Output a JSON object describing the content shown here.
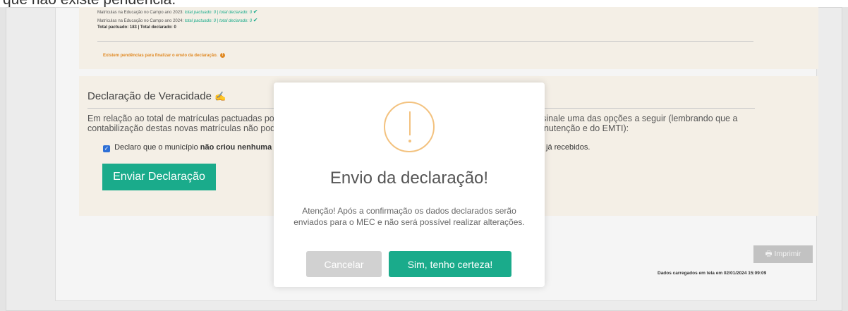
{
  "top_cut_text": "que não existe pendência.",
  "summary": {
    "line1_prefix": "Matrículas na Educação no Campo ano 2023:",
    "line1_values": "total pactuado: 0 | total declarado: 0",
    "line2_prefix": "Matrículas na Educação no Campo ano 2024:",
    "line2_values": "total pactuado: 0 | total declarado: 0",
    "total": "Total pactuado: 183 | Total declarado: 0",
    "pendencia": "Existem pendências para finalizar o envio da declaração.",
    "check_icon": "check-icon",
    "status_color": "#1aab8b",
    "warning_color": "#e08a25"
  },
  "declaracao": {
    "title": "Declaração de Veracidade",
    "title_icon": "signature-icon",
    "text_line1_left": "Em relação ao total de matrículas pactuadas por",
    "text_line1_right": ", assinale uma das opções a seguir (lembrando que a",
    "text_line2_left": "contabilização destas novas matrículas não pode",
    "text_line2_right": "anutenção e do EMTI):",
    "checkbox_label_prefix": "Declaro que o município",
    "checkbox_label_bold": "não criou nenhuma",
    "checkbox_label_suffix": "já recebidos.",
    "submit_label": "Enviar Declaração"
  },
  "footer": {
    "print_label": "Imprimir",
    "print_icon": "printer-icon",
    "loaded_text": "Dados carregados em tela em 02/01/2024 15:09:09"
  },
  "modal": {
    "icon": "warning-icon",
    "title": "Envio da declaração!",
    "text_line1": "Atenção! Após a confirmação os dados declarados serão",
    "text_line2": "enviados para o MEC e não será possível realizar alterações.",
    "cancel_label": "Cancelar",
    "confirm_label": "Sim, tenho certeza!",
    "accent_color": "#1aab8b",
    "icon_color": "#f3c27f"
  }
}
